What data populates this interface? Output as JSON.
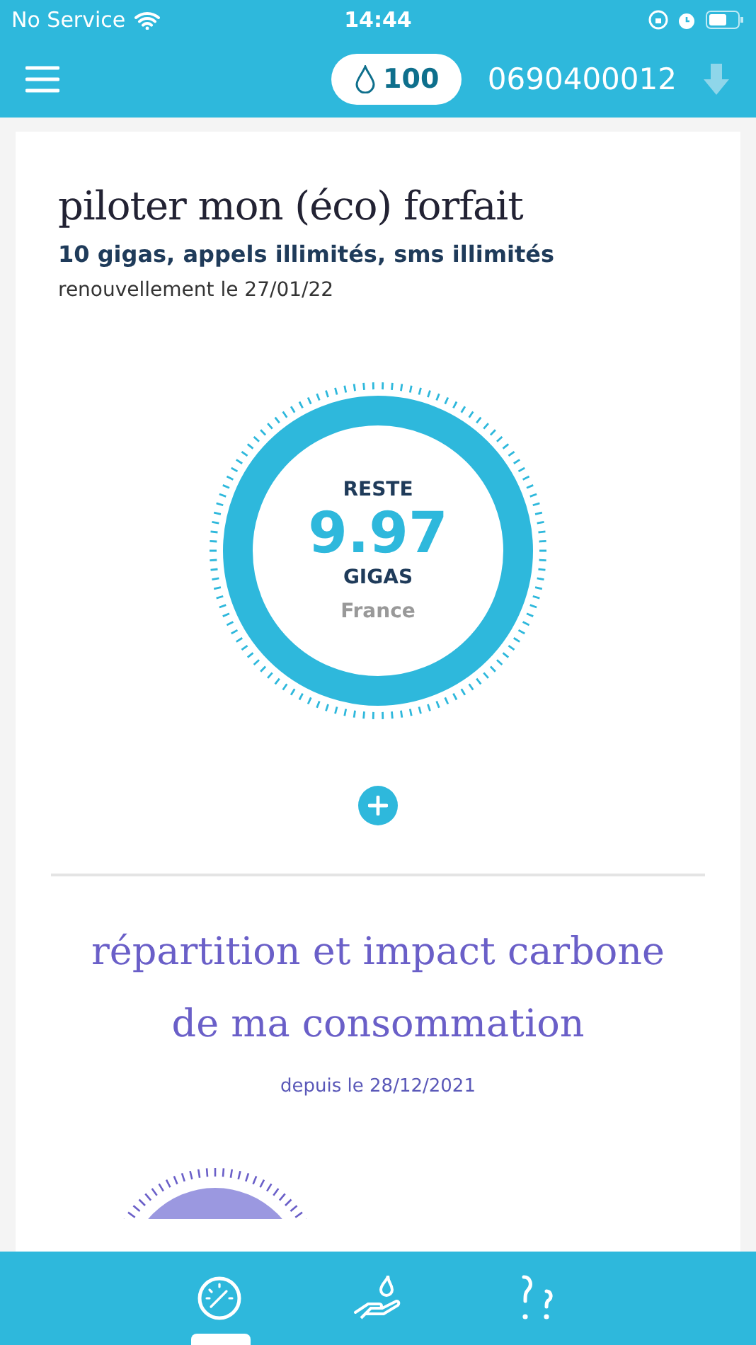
{
  "status_bar": {
    "carrier": "No Service",
    "time": "14:44"
  },
  "header": {
    "points": "100",
    "phone": "0690400012"
  },
  "plan": {
    "title": "piloter mon (éco) forfait",
    "summary": "10 gigas, appels illimités, sms illimités",
    "renewal": "renouvellement le 27/01/22"
  },
  "gauge": {
    "label": "RESTE",
    "value": "9.97",
    "unit": "GIGAS",
    "zone": "France"
  },
  "impact": {
    "title_lines": [
      "répartition et impact carbone",
      "de ma consommation"
    ],
    "since": "depuis le 28/12/2021"
  },
  "tabs": [
    {
      "kind": "gauge",
      "selected": true
    },
    {
      "kind": "hand",
      "selected": false
    },
    {
      "kind": "help",
      "selected": false
    }
  ]
}
